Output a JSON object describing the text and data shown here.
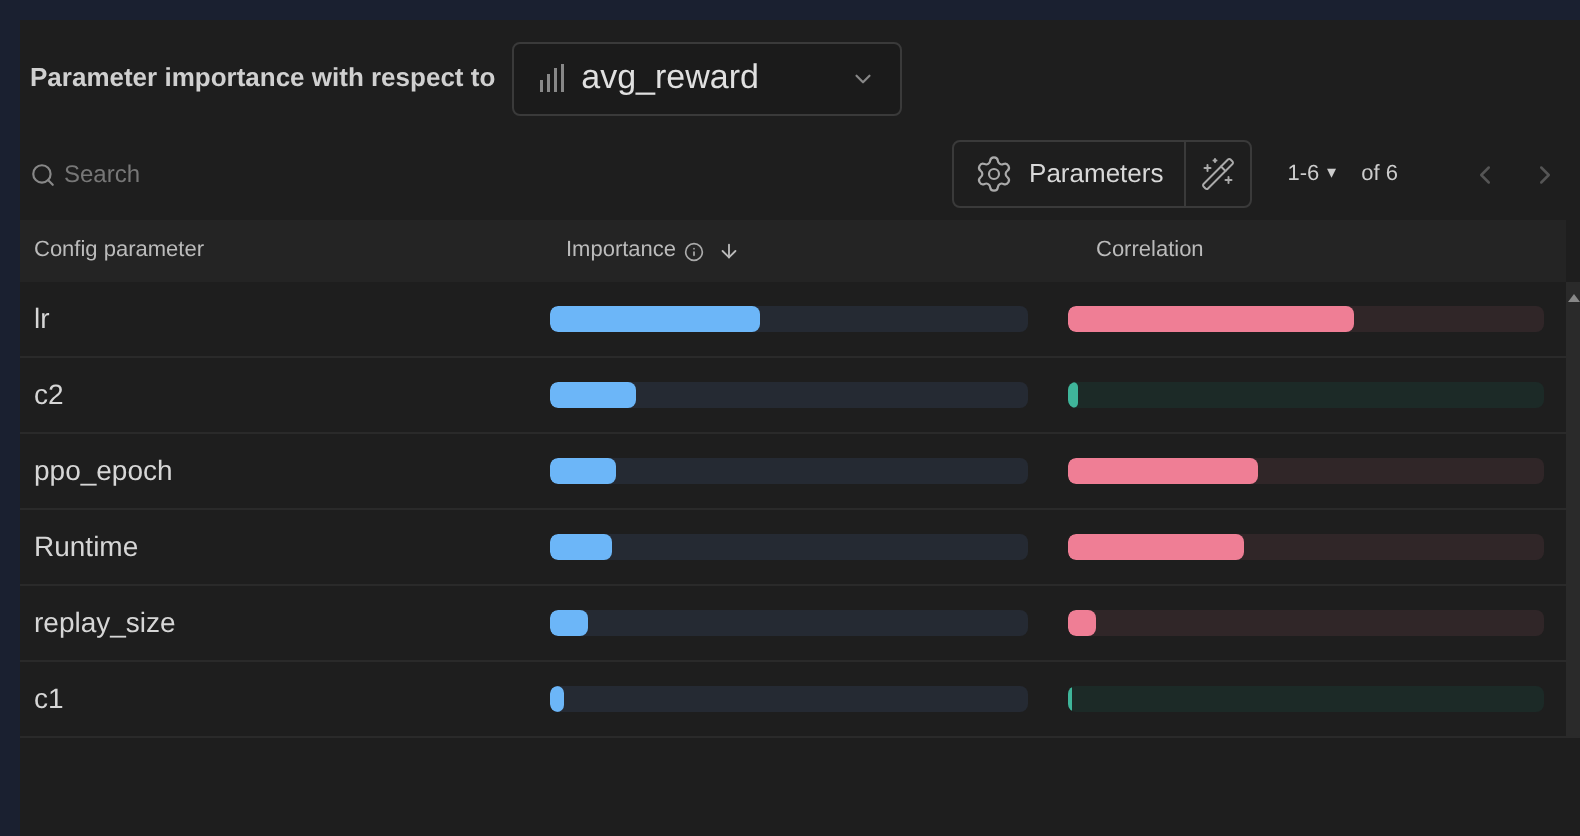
{
  "header": {
    "label": "Parameter importance with respect to",
    "metric": "avg_reward"
  },
  "search": {
    "placeholder": "Search"
  },
  "toolbar": {
    "parameters_button": "Parameters",
    "range": "1-6",
    "range_caret": "▾",
    "total": "of 6"
  },
  "table": {
    "columns": [
      "Config parameter",
      "Importance",
      "Correlation"
    ],
    "rows": [
      {
        "name": "lr",
        "importance": {
          "level": 0.44
        },
        "correlation": {
          "kind": "positive",
          "level": 0.6
        }
      },
      {
        "name": "c2",
        "importance": {
          "level": 0.18
        },
        "correlation": {
          "kind": "negative",
          "level": 0.02
        }
      },
      {
        "name": "ppo_epoch",
        "importance": {
          "level": 0.14
        },
        "correlation": {
          "kind": "positive",
          "level": 0.4
        }
      },
      {
        "name": "Runtime",
        "importance": {
          "level": 0.13
        },
        "correlation": {
          "kind": "positive",
          "level": 0.37
        }
      },
      {
        "name": "replay_size",
        "importance": {
          "level": 0.08
        },
        "correlation": {
          "kind": "positive",
          "level": 0.06
        }
      },
      {
        "name": "c1",
        "importance": {
          "level": 0.03
        },
        "correlation": {
          "kind": "negative",
          "level": 0.01
        }
      }
    ]
  }
}
